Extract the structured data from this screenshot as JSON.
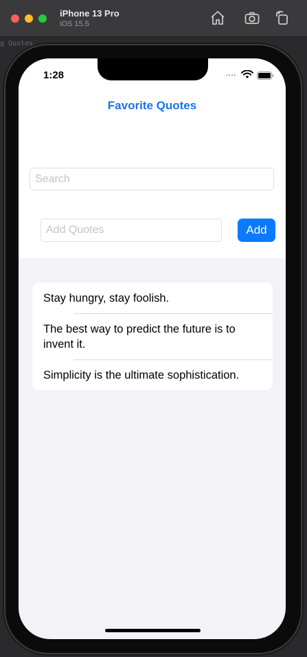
{
  "window": {
    "device_name": "iPhone 13 Pro",
    "device_os": "iOS 15.5",
    "behind_text": "g Quotes"
  },
  "toolbar": {
    "home_icon": "home-icon",
    "screenshot_icon": "camera-icon",
    "rotate_icon": "rotate-icon"
  },
  "status_bar": {
    "time": "1:28",
    "dots": "••••"
  },
  "nav": {
    "title": "Favorite Quotes"
  },
  "search": {
    "placeholder": "Search",
    "value": ""
  },
  "add_quote": {
    "placeholder": "Add Quotes",
    "value": "",
    "button_label": "Add"
  },
  "quotes": [
    "Stay hungry, stay foolish.",
    "The best way to predict the future is to invent it.",
    "Simplicity is the ultimate sophistication."
  ],
  "colors": {
    "accent": "#0a7aff",
    "title": "#1a73e8",
    "background": "#f2f2f7"
  }
}
